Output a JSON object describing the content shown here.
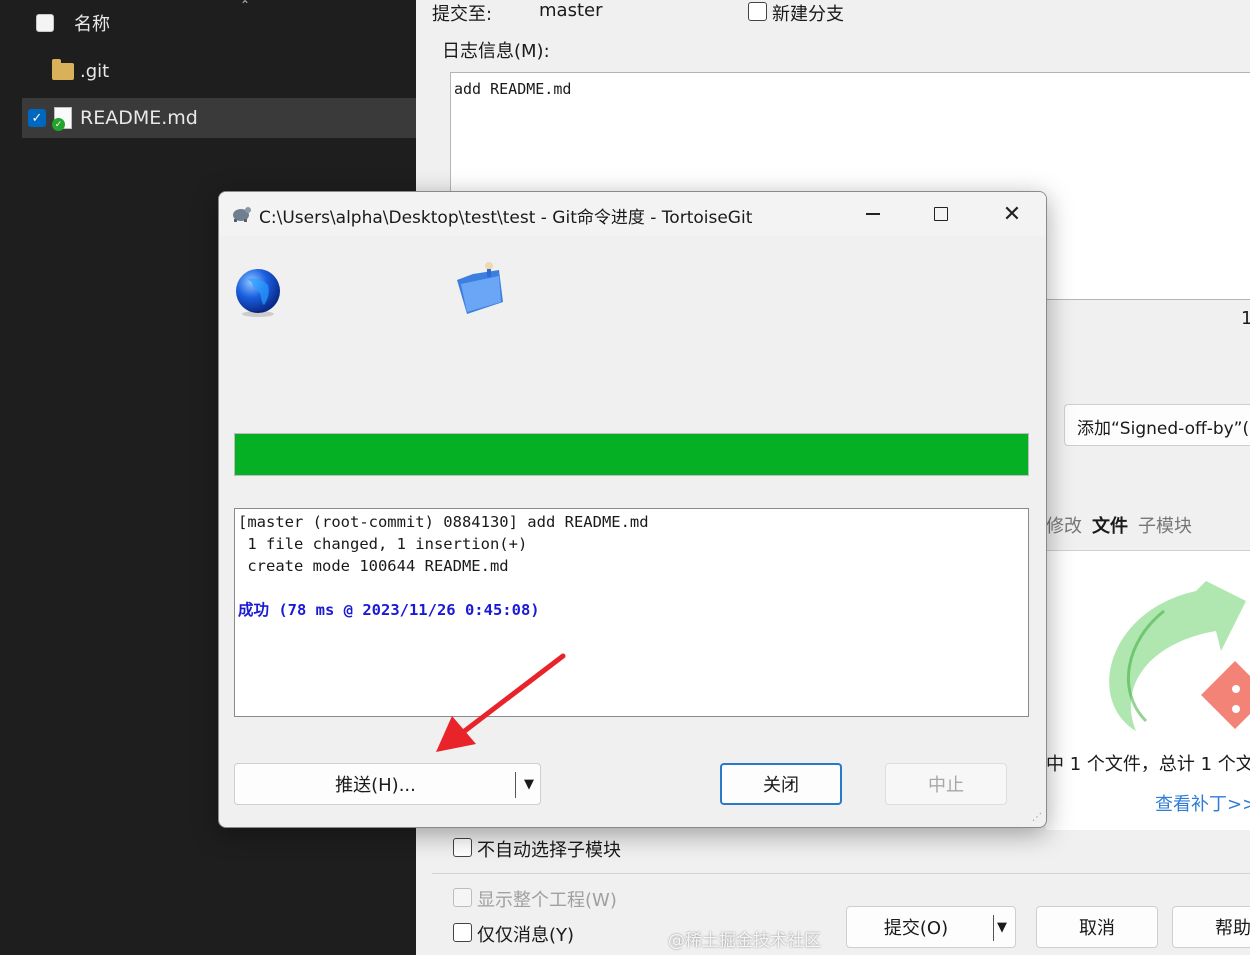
{
  "explorer": {
    "header_label": "名称",
    "items": [
      {
        "name": ".git"
      },
      {
        "name": "README.md"
      }
    ]
  },
  "commit_window": {
    "commit_to_label": "提交至:",
    "branch": "master",
    "new_branch_label": "新建分支",
    "log_label": "日志信息(M):",
    "log_message": "add README.md",
    "edge_counter": "1",
    "signoff_label": "添加“Signed-off-by”(S",
    "tabs": [
      "修改",
      "文件",
      "子模块"
    ],
    "status_text": "中 1 个文件，总计 1 个文",
    "view_patch_link": "查看补丁>>",
    "no_auto_submodule_label": "不自动选择子模块",
    "show_whole_project_label": "显示整个工程(W)",
    "message_only_label": "仅仅消息(Y)",
    "commit_button": "提交(O)",
    "cancel_button": "取消",
    "help_button": "帮助",
    "watermark": "@稀土掘金技术社区"
  },
  "dialog": {
    "title": "C:\\Users\\alpha\\Desktop\\test\\test - Git命令进度 - TortoiseGit",
    "progress_percent": 100,
    "progress_color": "#06b025",
    "output_lines": [
      "[master (root-commit) 0884130] add README.md",
      " 1 file changed, 1 insertion(+)",
      " create mode 100644 README.md"
    ],
    "success_line": "成功 (78 ms @ 2023/11/26 0:45:08)",
    "push_button": "推送(H)...",
    "close_button": "关闭",
    "abort_button": "中止"
  },
  "annotation": {
    "arrow_color": "#e8232a"
  }
}
